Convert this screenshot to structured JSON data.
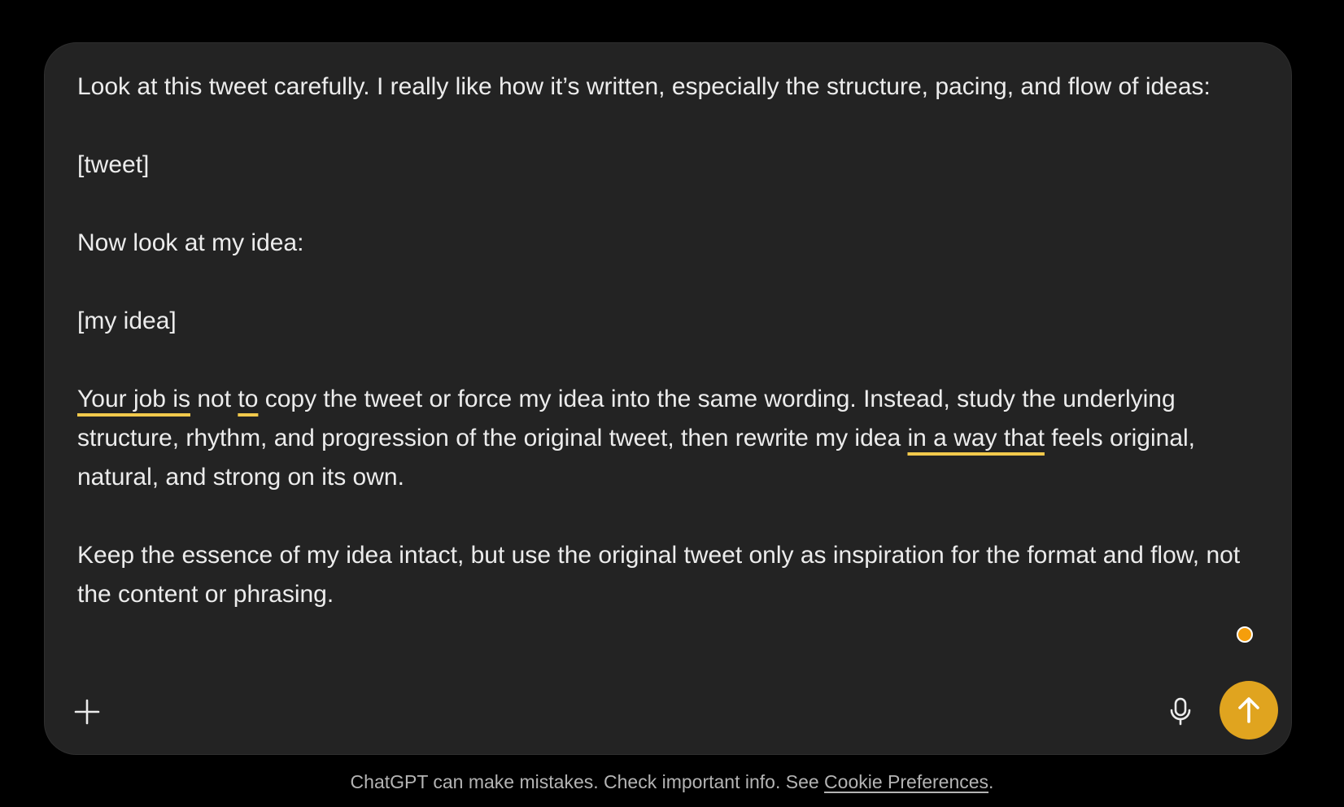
{
  "composer": {
    "paragraph_1": "Look at this tweet carefully. I really like how it’s written, especially the structure, pacing, and flow of ideas:",
    "paragraph_2": "[tweet]",
    "paragraph_3": "Now look at my idea:",
    "paragraph_4": "[my idea]",
    "paragraph_5": {
      "flag_1": "Your job is",
      "text_1": " not ",
      "flag_2": "to",
      "text_2": " copy the tweet or force my idea into the same wording. Instead, study the underlying structure, rhythm, and progression of the original tweet, then rewrite my idea ",
      "flag_3": "in a way that",
      "text_3": " feels original, natural, and strong on its own."
    },
    "paragraph_6": "Keep the essence of my idea intact, but use the original tweet only as inspiration for the format and flow, not the content or phrasing."
  },
  "toolbar": {
    "plus_icon": "plus-icon",
    "mic_icon": "microphone-icon",
    "send_icon": "arrow-up-icon"
  },
  "footer": {
    "disclaimer_text": "ChatGPT can make mistakes. Check important info. See ",
    "link_text": "Cookie Preferences",
    "period": "."
  },
  "colors": {
    "background": "#000000",
    "composer_bg": "#232323",
    "text": "#ececec",
    "flag_underline": "#f2c94c",
    "send_button": "#e0a41f",
    "status_dot": "#f59e0b"
  }
}
